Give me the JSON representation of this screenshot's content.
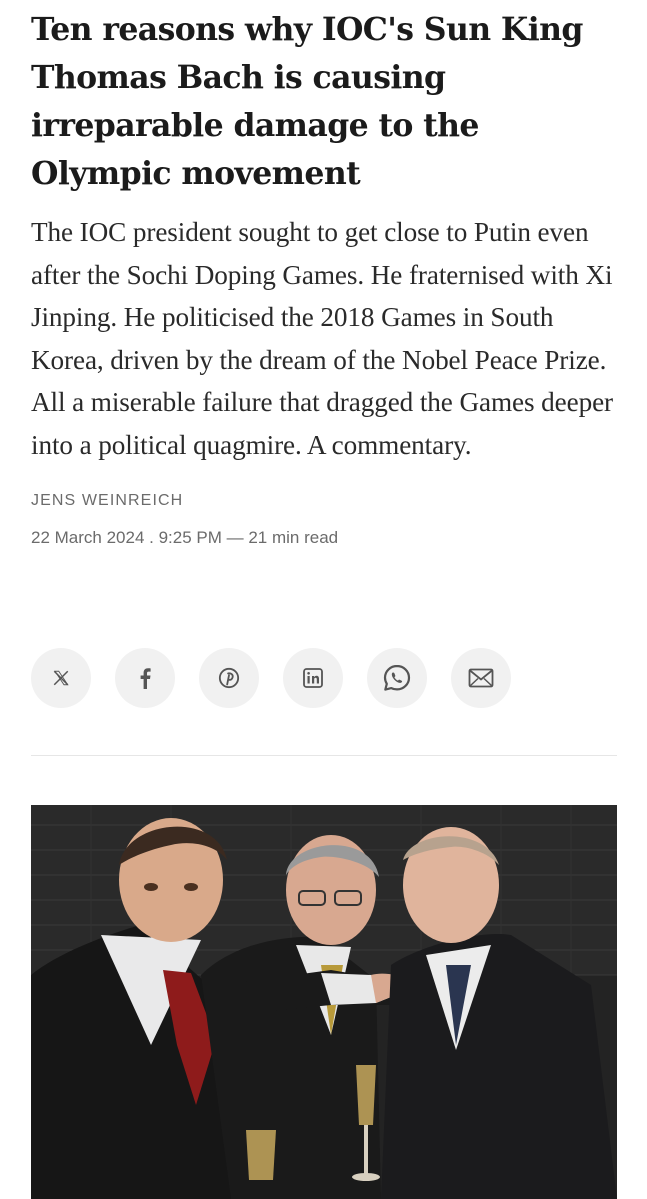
{
  "article": {
    "headline": "Ten reasons why IOC's Sun King Thomas Bach is causing irreparable damage to the Olympic movement",
    "standfirst": "The IOC president sought to get close to Putin even after the Sochi Doping Games. He fraternised with Xi Jinping. He politicised the 2018 Games in South Korea, driven by the dream of the Nobel Peace Prize. All a miserable failure that dragged the Games deeper into a political quagmire. A commentary.",
    "author": "JENS WEINREICH",
    "date": "22 March 2024",
    "time": "9:25 PM",
    "read_time": "21 min read",
    "meta_line": "22 March 2024 . 9:25 PM — 21 min read"
  },
  "share": {
    "buttons": [
      {
        "icon": "x-icon"
      },
      {
        "icon": "facebook-icon"
      },
      {
        "icon": "pinterest-icon"
      },
      {
        "icon": "linkedin-icon"
      },
      {
        "icon": "whatsapp-icon"
      },
      {
        "icon": "email-icon"
      }
    ]
  },
  "colors": {
    "text": "#1b1b1b",
    "muted": "#6b6b6b",
    "share_bg": "#f1f1f1",
    "icon": "#555555"
  }
}
